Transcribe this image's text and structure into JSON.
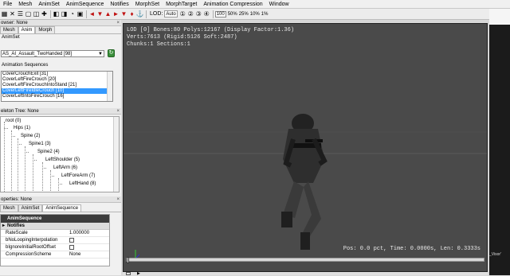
{
  "menu": [
    "File",
    "Mesh",
    "AnimSet",
    "AnimSequence",
    "Notifies",
    "MorphSet",
    "MorphTarget",
    "Animation Compression",
    "Window"
  ],
  "toolbar": {
    "lod_label": "LOD:",
    "lod_value": "Auto",
    "zoom": [
      "100",
      "50%",
      "25%",
      "10%",
      "1%"
    ]
  },
  "browser": {
    "title": "owser: None",
    "tabs": [
      "Mesh",
      "Anim",
      "Morph"
    ],
    "active_tab": "Anim",
    "animset_label": "AnimSet",
    "animset_value": "AS_AI_Assault_TwoHanded [98]",
    "sequences_label": "Animation Sequences",
    "sequences": [
      "CoverCrouchExit [31]",
      "CoverLeftFireCrouch [20]",
      "CoverLeftFireCrouchIntoStand [21]",
      "CoverLeftFireIdleCrouch [10]",
      "CoverLeftIntoFireCrouch [16]"
    ],
    "selected_index": 3
  },
  "skeleton": {
    "title": "eleton Tree: None",
    "nodes": [
      "root (0)",
      "Hips (1)",
      "Spine (2)",
      "Spine1 (3)",
      "Spine2 (4)",
      "LeftShoulder (5)",
      "LeftArm (6)",
      "LeftForeArm (7)",
      "LeftHand (8)"
    ]
  },
  "properties": {
    "title": "operties: None",
    "tabs": [
      "Mesh",
      "AnimSet",
      "AnimSequence"
    ],
    "active_tab": "AnimSequence",
    "header": "AnimSequence",
    "category": "Notifies",
    "rows": [
      {
        "name": "RateScale",
        "value": "1.000000"
      },
      {
        "name": "bNoLoopingInterpolation",
        "value": ""
      },
      {
        "name": "bIgnoreInitialRootOffset",
        "value": ""
      },
      {
        "name": "CompressionScheme",
        "value": "None"
      }
    ]
  },
  "viewport": {
    "line1": "LOD [0] Bones:80 Polys:12167 (Display Factor:1.36)",
    "line2": "Verts:7613 (Rigid:5126 Soft:2487)",
    "line3": "Chunks:1 Sections:1",
    "status": "Pos: 0.0 pct, Time: 0.0000s, Len: 0.3333s"
  },
  "rightstrip": {
    "label": "_Visor'"
  },
  "colors": {
    "viewport_bg": "#4a4a4a",
    "selection": "#3399ff",
    "prop_header": "#3c3c3c"
  }
}
